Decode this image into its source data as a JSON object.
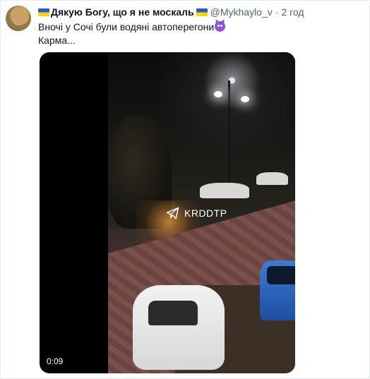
{
  "tweet": {
    "display_name": "Дякую Богу, що я не москаль",
    "handle": "@Mykhaylo_v",
    "separator": "·",
    "time": "2 год",
    "text_line1": "Вночі у Сочі були водяні автоперегони",
    "text_line2": "Карма...",
    "emoji_name_flag": "flag-ukraine-icon",
    "emoji_name_devil": "smiling-devil-icon"
  },
  "media": {
    "watermark": "KRDDTP",
    "duration": "0:09"
  },
  "colors": {
    "text_primary": "#0f1419",
    "text_secondary": "#536471",
    "flag_blue": "#1f5fc7",
    "flag_yellow": "#ffd400"
  }
}
